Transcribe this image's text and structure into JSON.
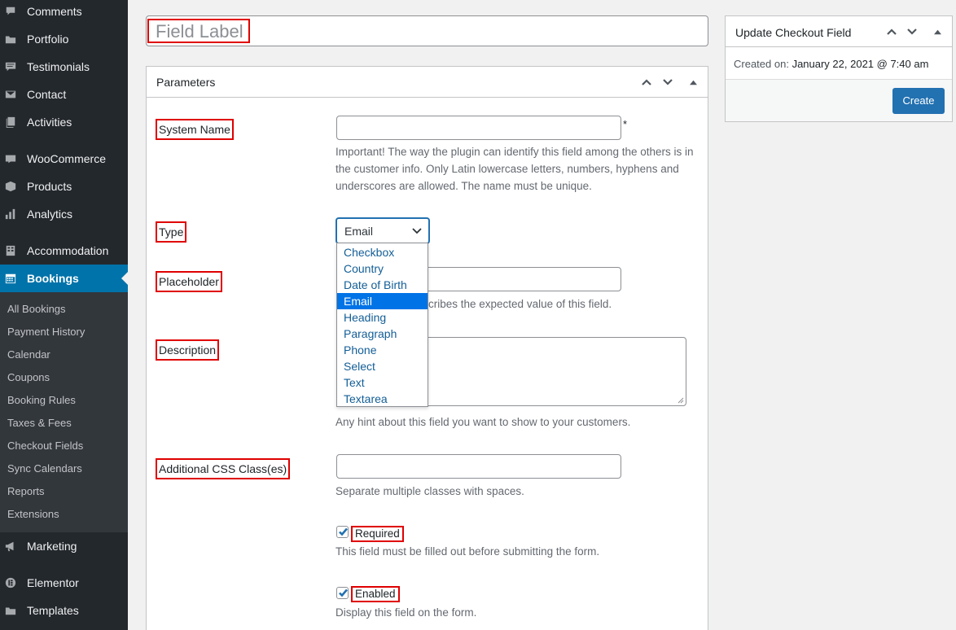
{
  "sidebar": {
    "menu": [
      {
        "label": "Comments",
        "icon": "comments-icon"
      },
      {
        "label": "Portfolio",
        "icon": "portfolio-icon"
      },
      {
        "label": "Testimonials",
        "icon": "testimonials-icon"
      },
      {
        "label": "Contact",
        "icon": "contact-icon"
      },
      {
        "label": "Activities",
        "icon": "activities-icon"
      },
      {
        "label": "WooCommerce",
        "icon": "woocommerce-icon"
      },
      {
        "label": "Products",
        "icon": "products-icon"
      },
      {
        "label": "Analytics",
        "icon": "analytics-icon"
      },
      {
        "label": "Accommodation",
        "icon": "accommodation-icon"
      },
      {
        "label": "Bookings",
        "icon": "calendar-icon"
      },
      {
        "label": "Marketing",
        "icon": "megaphone-icon"
      },
      {
        "label": "Elementor",
        "icon": "elementor-icon"
      },
      {
        "label": "Templates",
        "icon": "templates-icon"
      }
    ],
    "submenu": [
      "All Bookings",
      "Payment History",
      "Calendar",
      "Coupons",
      "Booking Rules",
      "Taxes & Fees",
      "Checkout Fields",
      "Sync Calendars",
      "Reports",
      "Extensions"
    ]
  },
  "title_placeholder": "Field Label",
  "parameters": {
    "title": "Parameters",
    "system_name_label": "System Name",
    "system_name_hint": "Important! The way the plugin can identify this field among the others is in the customer info. Only Latin lowercase letters, numbers, hyphens and underscores are allowed. The name must be unique.",
    "required_mark": "*",
    "type_label": "Type",
    "type_value": "Email",
    "type_options": [
      "Checkbox",
      "Country",
      "Date of Birth",
      "Email",
      "Heading",
      "Paragraph",
      "Phone",
      "Select",
      "Text",
      "Textarea"
    ],
    "placeholder_label": "Placeholder",
    "placeholder_hint_visible": "cribes the expected value of this field.",
    "description_label": "Description",
    "description_hint": "Any hint about this field you want to show to your customers.",
    "css_label": "Additional CSS Class(es)",
    "css_hint": "Separate multiple classes with spaces.",
    "required_label": "Required",
    "required_hint": "This field must be filled out before submitting the form.",
    "enabled_label": "Enabled",
    "enabled_hint": "Display this field on the form."
  },
  "publish": {
    "title": "Update Checkout Field",
    "created_prefix": "Created on:",
    "created_date": "January 22, 2021 @ 7:40 am",
    "create_button": "Create"
  },
  "colors": {
    "accent": "#2271b1",
    "sidebar": "#23282d",
    "highlight": "#e00000"
  }
}
